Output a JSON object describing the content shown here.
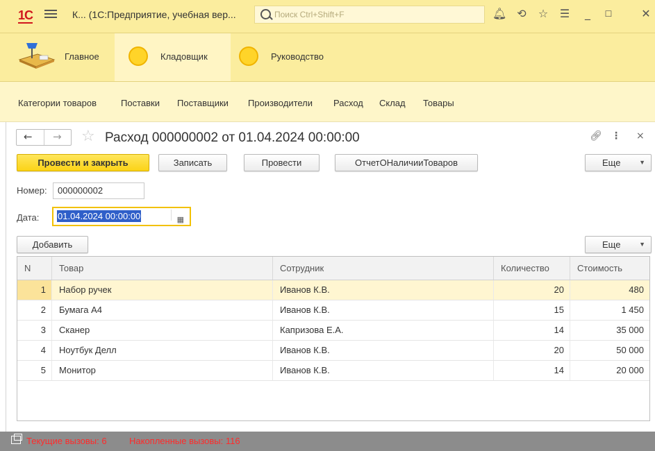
{
  "app": {
    "logo_text": "1С",
    "title": "К... (1С:Предприятие, учебная вер...",
    "search_placeholder": "Поиск Ctrl+Shift+F",
    "icons": [
      "bell-icon",
      "history-icon",
      "star-icon",
      "menu-lines-icon",
      "minimize-icon",
      "maximize-icon",
      "close-icon"
    ]
  },
  "sections": [
    {
      "label": "Главное",
      "icon": "desk-lamp-icon"
    },
    {
      "label": "Кладовщик",
      "icon": "circle-icon",
      "active": true
    },
    {
      "label": "Руководство",
      "icon": "circle-icon"
    }
  ],
  "nav": [
    "Категории товаров",
    "Поставки",
    "Поставщики",
    "Производители",
    "Расход",
    "Склад",
    "Товары"
  ],
  "form": {
    "title": "Расход 000000002 от 01.04.2024 00:00:00",
    "buttons": {
      "post_close": "Провести и закрыть",
      "save": "Записать",
      "post": "Провести",
      "report": "ОтчетОНаличииТоваров",
      "more": "Еще"
    },
    "number_label": "Номер:",
    "number_value": "000000002",
    "date_label": "Дата:",
    "date_value": "01.04.2024 00:00:00",
    "add_button": "Добавить",
    "table_more": "Еще"
  },
  "table": {
    "columns": [
      "N",
      "Товар",
      "Сотрудник",
      "Количество",
      "Стоимость"
    ],
    "rows": [
      {
        "n": "1",
        "item": "Набор ручек",
        "employee": "Иванов К.В.",
        "qty": "20",
        "cost": "480",
        "selected": true
      },
      {
        "n": "2",
        "item": "Бумага А4",
        "employee": "Иванов К.В.",
        "qty": "15",
        "cost": "1 450"
      },
      {
        "n": "3",
        "item": "Сканер",
        "employee": "Капризова Е.А.",
        "qty": "14",
        "cost": "35 000"
      },
      {
        "n": "4",
        "item": "Ноутбук Делл",
        "employee": "Иванов К.В.",
        "qty": "20",
        "cost": "50 000"
      },
      {
        "n": "5",
        "item": "Монитор",
        "employee": "Иванов К.В.",
        "qty": "14",
        "cost": "20 000"
      }
    ]
  },
  "status": {
    "current_calls": "Текущие вызовы: 6",
    "accumulated_calls": "Накопленные вызовы: 116"
  },
  "colors": {
    "panel_yellow": "#fbed9e",
    "accent_button": "#fbd316",
    "selected_row": "#fff6d1",
    "status_text": "#ff2b2b"
  }
}
